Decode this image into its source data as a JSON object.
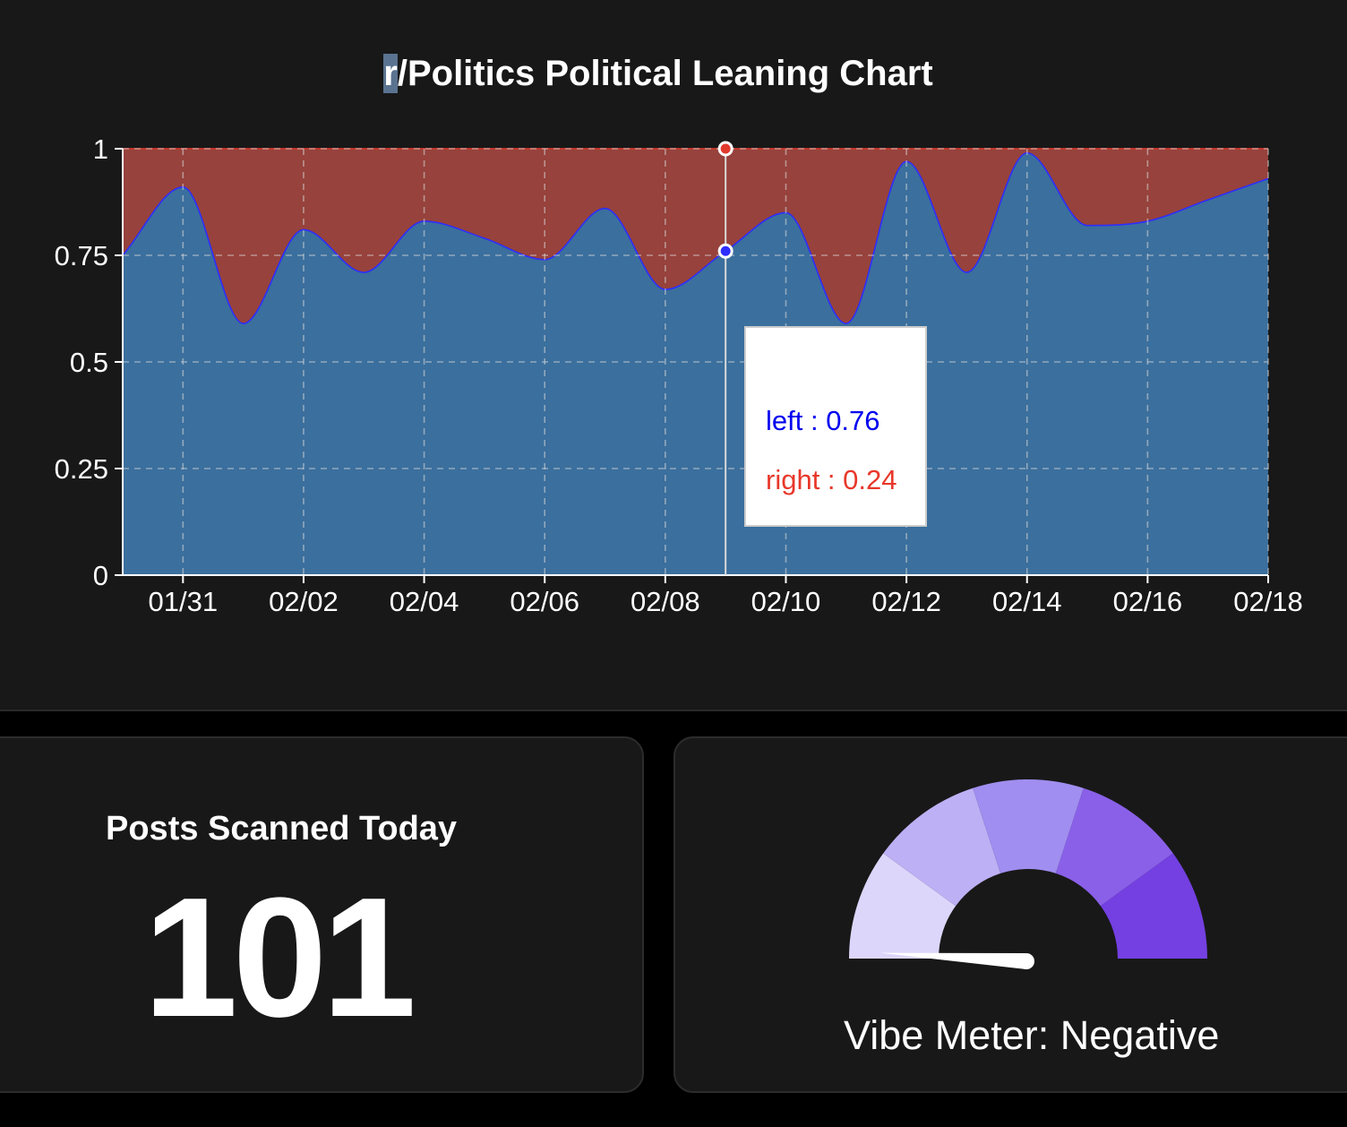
{
  "chart_title_first": "r",
  "chart_title_rest": "/Politics Political Leaning Chart",
  "chart_data": {
    "type": "area",
    "stacked": true,
    "x": [
      "01/30",
      "01/31",
      "02/01",
      "02/02",
      "02/03",
      "02/04",
      "02/05",
      "02/06",
      "02/07",
      "02/08",
      "02/09",
      "02/10",
      "02/11",
      "02/12",
      "02/13",
      "02/14",
      "02/15",
      "02/16",
      "02/17",
      "02/18"
    ],
    "series": [
      {
        "name": "left",
        "color": "#3b6f9d",
        "line_color": "#2d2dff",
        "values": [
          0.75,
          0.91,
          0.59,
          0.81,
          0.71,
          0.83,
          0.79,
          0.74,
          0.86,
          0.67,
          0.76,
          0.85,
          0.59,
          0.97,
          0.71,
          0.99,
          0.82,
          0.83,
          0.88,
          0.93
        ]
      },
      {
        "name": "right",
        "color": "#97423c",
        "values": [
          0.25,
          0.09,
          0.41,
          0.19,
          0.29,
          0.17,
          0.21,
          0.26,
          0.14,
          0.33,
          0.24,
          0.15,
          0.41,
          0.03,
          0.29,
          0.01,
          0.18,
          0.17,
          0.12,
          0.07
        ]
      }
    ],
    "x_tick_labels": [
      "01/31",
      "02/02",
      "02/04",
      "02/06",
      "02/08",
      "02/10",
      "02/12",
      "02/14",
      "02/16",
      "02/18"
    ],
    "y_ticks": [
      0,
      0.25,
      0.5,
      0.75,
      1
    ],
    "y_tick_labels": [
      "0",
      "0.25",
      "0.5",
      "0.75",
      "1"
    ],
    "ylim": [
      0,
      1
    ],
    "grid": true,
    "hover_index": 10,
    "tooltip": {
      "left_text": "left : 0.76",
      "right_text": "right : 0.24"
    }
  },
  "posts": {
    "label": "Posts Scanned Today",
    "value": "101"
  },
  "vibe": {
    "label": "Vibe Meter: Negative",
    "level": 0.06,
    "segment_colors": [
      "#ddd6fb",
      "#bdb0f5",
      "#a08ef0",
      "#8a60e8",
      "#7440e2"
    ],
    "needle_color": "#ffffff"
  }
}
